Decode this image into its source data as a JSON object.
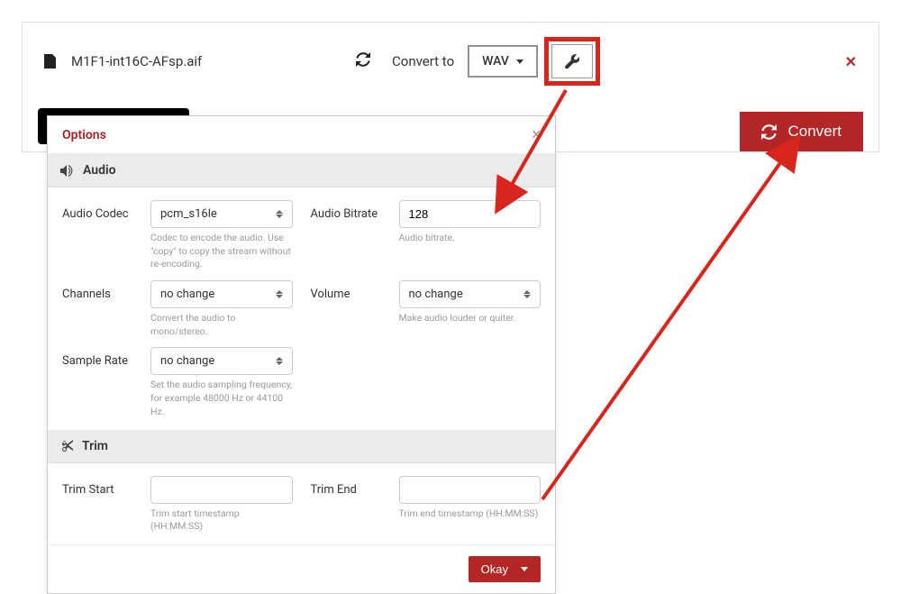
{
  "file": {
    "name": "M1F1-int16C-AFsp.aif"
  },
  "toolbar": {
    "convert_to_label": "Convert to",
    "format_selected": "WAV",
    "convert_label": "Convert"
  },
  "options_panel": {
    "title": "Options",
    "audio_section": {
      "title": "Audio",
      "codec": {
        "label": "Audio Codec",
        "value": "pcm_s16le",
        "help": "Codec to encode the audio. Use \"copy\" to copy the stream without re-encoding."
      },
      "bitrate": {
        "label": "Audio Bitrate",
        "value": "128",
        "help": "Audio bitrate."
      },
      "channels": {
        "label": "Channels",
        "value": "no change",
        "help": "Convert the audio to mono/stereo."
      },
      "volume": {
        "label": "Volume",
        "value": "no change",
        "help": "Make audio louder or quiter."
      },
      "sample_rate": {
        "label": "Sample Rate",
        "value": "no change",
        "help": "Set the audio sampling frequency, for example 48000 Hz or 44100 Hz."
      }
    },
    "trim_section": {
      "title": "Trim",
      "start": {
        "label": "Trim Start",
        "value": "",
        "help": "Trim start timestamp (HH:MM:SS)"
      },
      "end": {
        "label": "Trim End",
        "value": "",
        "help": "Trim end timestamp (HH:MM:SS)"
      }
    },
    "okay_label": "Okay"
  }
}
